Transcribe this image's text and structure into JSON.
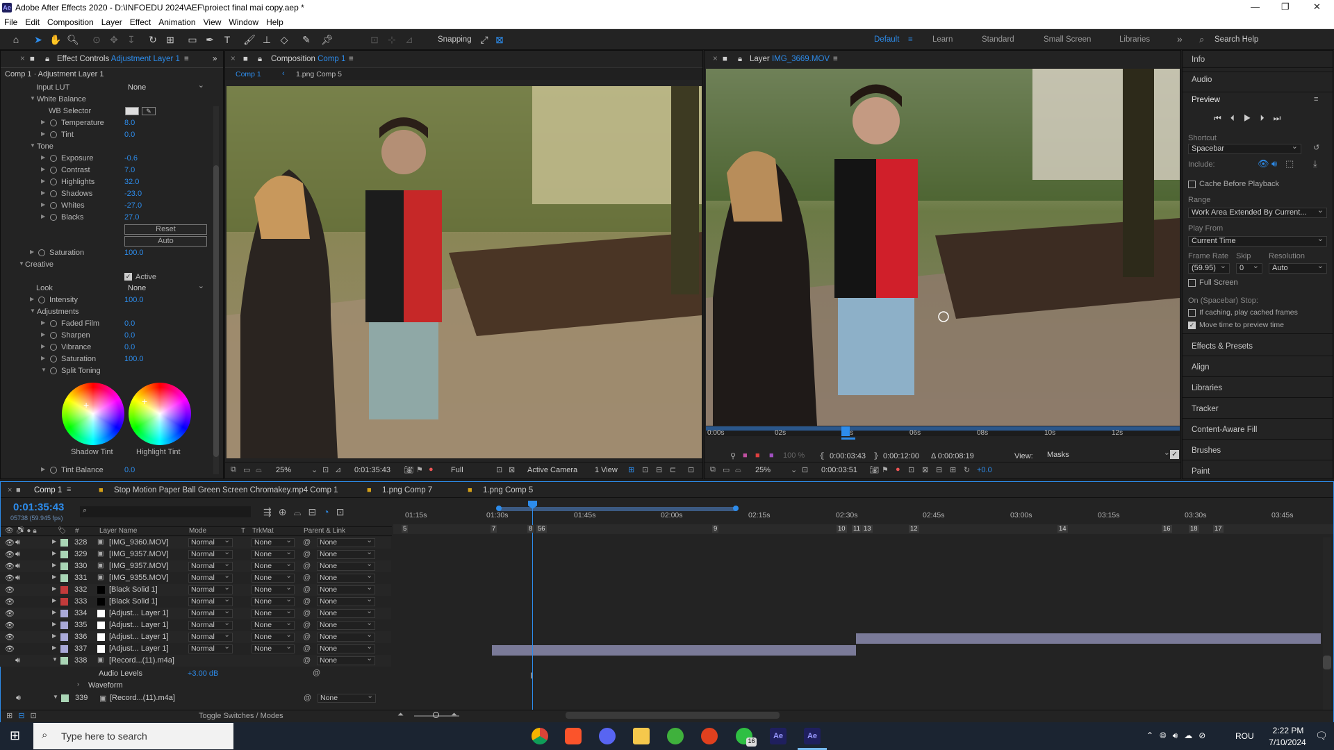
{
  "window": {
    "title": "Adobe After Effects 2020 - D:\\INFOEDU 2024\\AEF\\proiect final mai copy.aep *"
  },
  "menu": [
    "File",
    "Edit",
    "Composition",
    "Layer",
    "Effect",
    "Animation",
    "View",
    "Window",
    "Help"
  ],
  "toolbar": {
    "snapping": "Snapping",
    "workspaces": [
      "Default",
      "Learn",
      "Standard",
      "Small Screen",
      "Libraries"
    ],
    "search_placeholder": "Search Help"
  },
  "effect_controls": {
    "tab_prefix": "Effect Controls",
    "tab_layer": "Adjustment Layer 1",
    "subtitle": "Comp 1 · Adjustment Layer 1",
    "input_lut_label": "Input LUT",
    "input_lut_value": "None",
    "wb_label": "White Balance",
    "wb_selector": "WB Selector",
    "temperature_label": "Temperature",
    "temperature": "8.0",
    "tint_label": "Tint",
    "tint": "0.0",
    "tone_label": "Tone",
    "exposure_label": "Exposure",
    "exposure": "-0.6",
    "contrast_label": "Contrast",
    "contrast": "7.0",
    "highlights_label": "Highlights",
    "highlights": "32.0",
    "shadows_label": "Shadows",
    "shadows": "-23.0",
    "whites_label": "Whites",
    "whites": "-27.0",
    "blacks_label": "Blacks",
    "blacks": "27.0",
    "reset": "Reset",
    "auto": "Auto",
    "saturation_label": "Saturation",
    "saturation": "100.0",
    "creative_label": "Creative",
    "active_label": "Active",
    "look_label": "Look",
    "look_value": "None",
    "intensity_label": "Intensity",
    "intensity": "100.0",
    "adjustments_label": "Adjustments",
    "faded_film_label": "Faded Film",
    "faded_film": "0.0",
    "sharpen_label": "Sharpen",
    "sharpen": "0.0",
    "vibrance_label": "Vibrance",
    "vibrance": "0.0",
    "saturation2_label": "Saturation",
    "saturation2": "100.0",
    "split_toning_label": "Split Toning",
    "shadow_tint": "Shadow Tint",
    "highlight_tint": "Highlight Tint",
    "tint_balance_label": "Tint Balance",
    "tint_balance": "0.0"
  },
  "composition": {
    "tab_prefix": "Composition",
    "tab_name": "Comp 1",
    "crumbs": [
      "Comp 1",
      "1.png Comp 5"
    ],
    "zoom": "25%",
    "timecode": "0:01:35:43",
    "resolution": "Full",
    "camera": "Active Camera",
    "views": "1 View"
  },
  "layer_panel": {
    "tab_prefix": "Layer",
    "tab_name": "IMG_3669.MOV",
    "ruler": [
      "0:00s",
      "02s",
      "04s",
      "06s",
      "08s",
      "10s",
      "12s"
    ],
    "in_time": "0:00:03:43",
    "out_time": "0:00:12:00",
    "duration": "Δ 0:00:08:19",
    "view_label": "View:",
    "view_value": "Masks",
    "zoom": "25%",
    "timecode": "0:00:03:51",
    "exposure": "+0.0",
    "opacity": "100 %"
  },
  "right_panel": {
    "info": "Info",
    "audio": "Audio",
    "preview": "Preview",
    "shortcut_label": "Shortcut",
    "shortcut": "Spacebar",
    "include_label": "Include:",
    "cache_before": "Cache Before Playback",
    "range_label": "Range",
    "range": "Work Area Extended By Current...",
    "play_from_label": "Play From",
    "play_from": "Current Time",
    "frame_rate_label": "Frame Rate",
    "skip_label": "Skip",
    "resolution_label": "Resolution",
    "frame_rate": "(59.95)",
    "skip": "0",
    "resolution": "Auto",
    "full_screen": "Full Screen",
    "on_stop": "On (Spacebar) Stop:",
    "if_caching": "If caching, play cached frames",
    "move_time": "Move time to preview time",
    "items": [
      "Effects & Presets",
      "Align",
      "Libraries",
      "Tracker",
      "Content-Aware Fill",
      "Brushes",
      "Paint"
    ]
  },
  "timeline": {
    "tabs": [
      "Comp 1",
      "Stop Motion Paper Ball Green Screen Chromakey.mp4 Comp 1",
      "1.png Comp 7",
      "1.png Comp 5"
    ],
    "timecode": "0:01:35:43",
    "fps": "05738 (59.945 fps)",
    "col_headers": {
      "num": "#",
      "name": "Layer Name",
      "mode": "Mode",
      "t": "T",
      "trkmat": "TrkMat",
      "parent": "Parent & Link"
    },
    "ruler": [
      "01:15s",
      "01:30s",
      "01:45s",
      "02:00s",
      "02:15s",
      "02:30s",
      "02:45s",
      "03:00s",
      "03:15s",
      "03:30s",
      "03:45s"
    ],
    "markers": [
      "5",
      "7",
      "8",
      "56",
      "9",
      "10",
      "11",
      "13",
      "12",
      "14",
      "16",
      "18",
      "17"
    ],
    "layers": [
      {
        "num": "328",
        "name": "[IMG_9360.MOV]",
        "mode": "Normal",
        "trkmat": "None",
        "parent": "None",
        "color": "#a9d5b5"
      },
      {
        "num": "329",
        "name": "[IMG_9357.MOV]",
        "mode": "Normal",
        "trkmat": "None",
        "parent": "None",
        "color": "#a9d5b5"
      },
      {
        "num": "330",
        "name": "[IMG_9357.MOV]",
        "mode": "Normal",
        "trkmat": "None",
        "parent": "None",
        "color": "#a9d5b5"
      },
      {
        "num": "331",
        "name": "[IMG_9355.MOV]",
        "mode": "Normal",
        "trkmat": "None",
        "parent": "None",
        "color": "#a9d5b5"
      },
      {
        "num": "332",
        "name": "[Black Solid 1]",
        "mode": "Normal",
        "trkmat": "None",
        "parent": "None",
        "color": "#c23b3b"
      },
      {
        "num": "333",
        "name": "[Black Solid 1]",
        "mode": "Normal",
        "trkmat": "None",
        "parent": "None",
        "color": "#c23b3b"
      },
      {
        "num": "334",
        "name": "[Adjust... Layer 1]",
        "mode": "Normal",
        "trkmat": "None",
        "parent": "None",
        "color": "#a9a9d8"
      },
      {
        "num": "335",
        "name": "[Adjust... Layer 1]",
        "mode": "Normal",
        "trkmat": "None",
        "parent": "None",
        "color": "#a9a9d8"
      },
      {
        "num": "336",
        "name": "[Adjust... Layer 1]",
        "mode": "Normal",
        "trkmat": "None",
        "parent": "None",
        "color": "#a9a9d8"
      },
      {
        "num": "337",
        "name": "[Adjust... Layer 1]",
        "mode": "Normal",
        "trkmat": "None",
        "parent": "None",
        "color": "#a9a9d8"
      },
      {
        "num": "338",
        "name": "[Record...(11).m4a]",
        "mode": "",
        "trkmat": "",
        "parent": "None",
        "color": "#a9d5b5"
      }
    ],
    "audio_levels_label": "Audio Levels",
    "audio_levels": "+3.00 dB",
    "waveform": "Waveform",
    "layer_339": {
      "num": "339",
      "name": "[Record...(11).m4a]",
      "parent": "None"
    },
    "toggle": "Toggle Switches / Modes"
  },
  "taskbar": {
    "search_placeholder": "Type here to search",
    "lang": "ROU",
    "time": "2:22 PM",
    "date": "7/10/2024",
    "badge": "16"
  }
}
